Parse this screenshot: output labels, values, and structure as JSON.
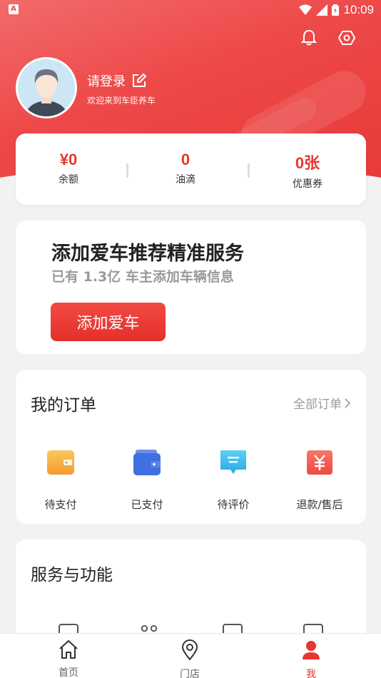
{
  "status_bar": {
    "time": "10:09",
    "app_badge": "A"
  },
  "profile": {
    "login_label": "请登录",
    "welcome_text": "欢迎来到车臣养车"
  },
  "stats": [
    {
      "value": "¥0",
      "label": "余额"
    },
    {
      "value": "0",
      "label": "油滴"
    },
    {
      "value": "0张",
      "label": "优惠券"
    }
  ],
  "car_promo": {
    "title": "添加爱车推荐精准服务",
    "subtitle": "已有 1.3亿 车主添加车辆信息",
    "button_label": "添加爱车"
  },
  "orders": {
    "title": "我的订单",
    "all_label": "全部订单",
    "items": [
      {
        "label": "待支付",
        "icon": "wallet-orange-icon"
      },
      {
        "label": "已支付",
        "icon": "wallet-blue-icon"
      },
      {
        "label": "待评价",
        "icon": "comment-icon"
      },
      {
        "label": "退款/售后",
        "icon": "refund-icon"
      }
    ]
  },
  "services": {
    "title": "服务与功能"
  },
  "tabbar": {
    "items": [
      {
        "label": "首页",
        "icon": "home-icon"
      },
      {
        "label": "门店",
        "icon": "location-icon"
      },
      {
        "label": "我",
        "icon": "user-icon",
        "active": true
      }
    ]
  },
  "colors": {
    "brand_red": "#e8362f",
    "orange": "#f5a623",
    "blue": "#3f6fe0",
    "cyan": "#2fb0e8",
    "coral": "#f2564b"
  }
}
